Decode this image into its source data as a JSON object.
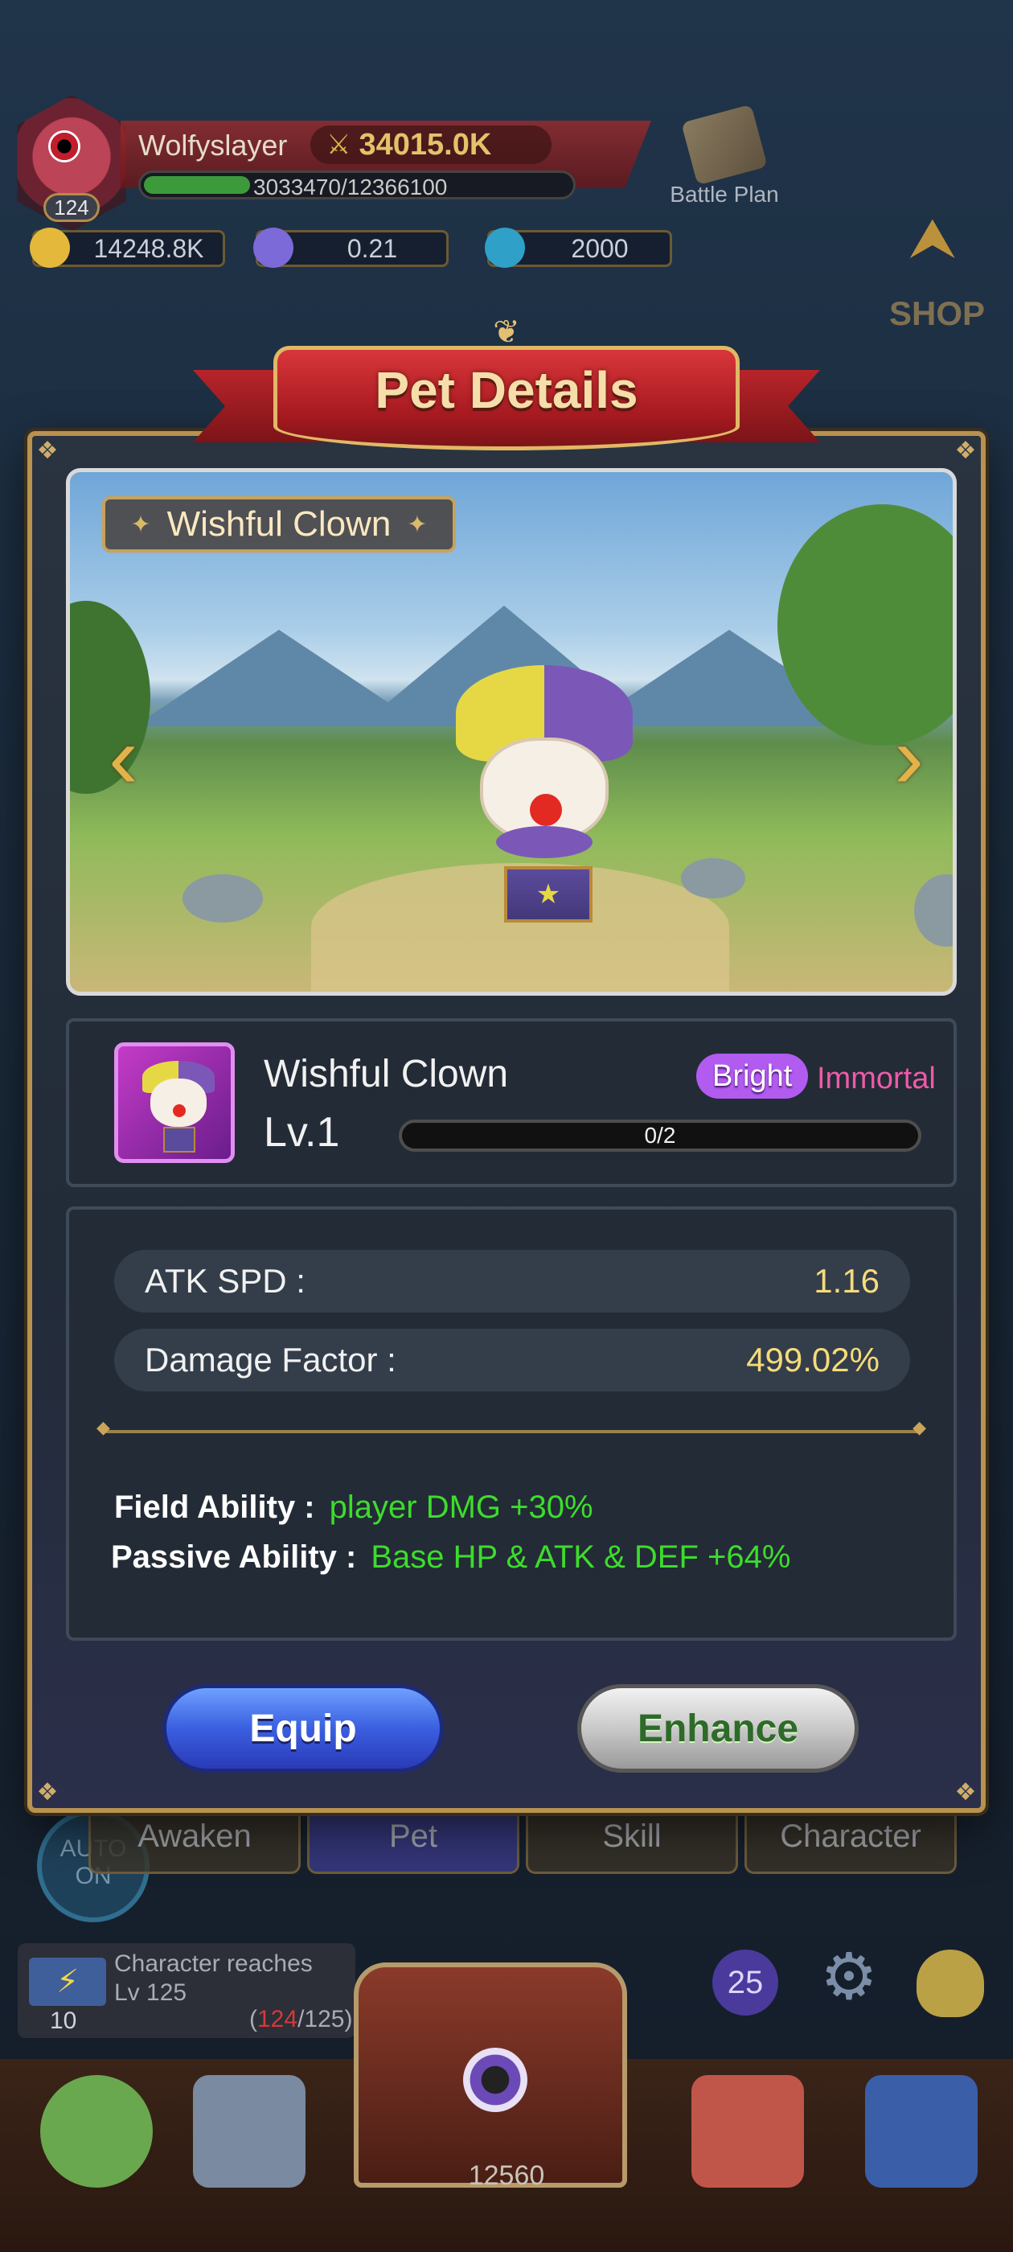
{
  "hud": {
    "level": "124",
    "player_name": "Wolfyslayer",
    "power": "34015.0K",
    "exp_text": "3033470/12366100",
    "exp_fraction": 0.245,
    "battle_plan_label": "Battle Plan",
    "currencies": [
      {
        "name": "gold-coin-icon",
        "value": "14248.8K",
        "color": "#e4b83a"
      },
      {
        "name": "star-shard-icon",
        "value": "0.21",
        "color": "#7b6ad8"
      },
      {
        "name": "gem-icon",
        "value": "2000",
        "color": "#2fa0c8"
      }
    ],
    "shop_label": "SHOP"
  },
  "modal": {
    "title": "Pet Details",
    "pet_tag": "Wishful Clown",
    "pet_name": "Wishful Clown",
    "level": "Lv.1",
    "progress_text": "0/2",
    "rarity": "Bright",
    "grade": "Immortal",
    "stats": [
      {
        "label": "ATK SPD :",
        "value": "1.16"
      },
      {
        "label": "Damage Factor :",
        "value": "499.02%"
      }
    ],
    "field_ability_label": "Field Ability :",
    "field_ability_value": "player DMG +30%",
    "passive_ability_label": "Passive Ability :",
    "passive_ability_value": "Base HP & ATK & DEF +64%",
    "equip_label": "Equip",
    "enhance_label": "Enhance"
  },
  "bottom": {
    "auto_label": "AUTO ON",
    "tabs": [
      "Awaken",
      "Pet",
      "Skill",
      "Character"
    ],
    "quest_text_1": "Character reaches",
    "quest_text_2": "Lv 125",
    "quest_num": "10",
    "quest_current": "124",
    "quest_target": "/125)",
    "quest_open": "(",
    "badge_count": "25",
    "chest_count": "12560"
  },
  "colors": {
    "accent_gold": "#b8924f",
    "rarity_purple": "#b25bf0",
    "grade_pink": "#ee5aa8",
    "ability_green": "#3ddc2c",
    "stat_value_yellow": "#f5dc7a"
  }
}
